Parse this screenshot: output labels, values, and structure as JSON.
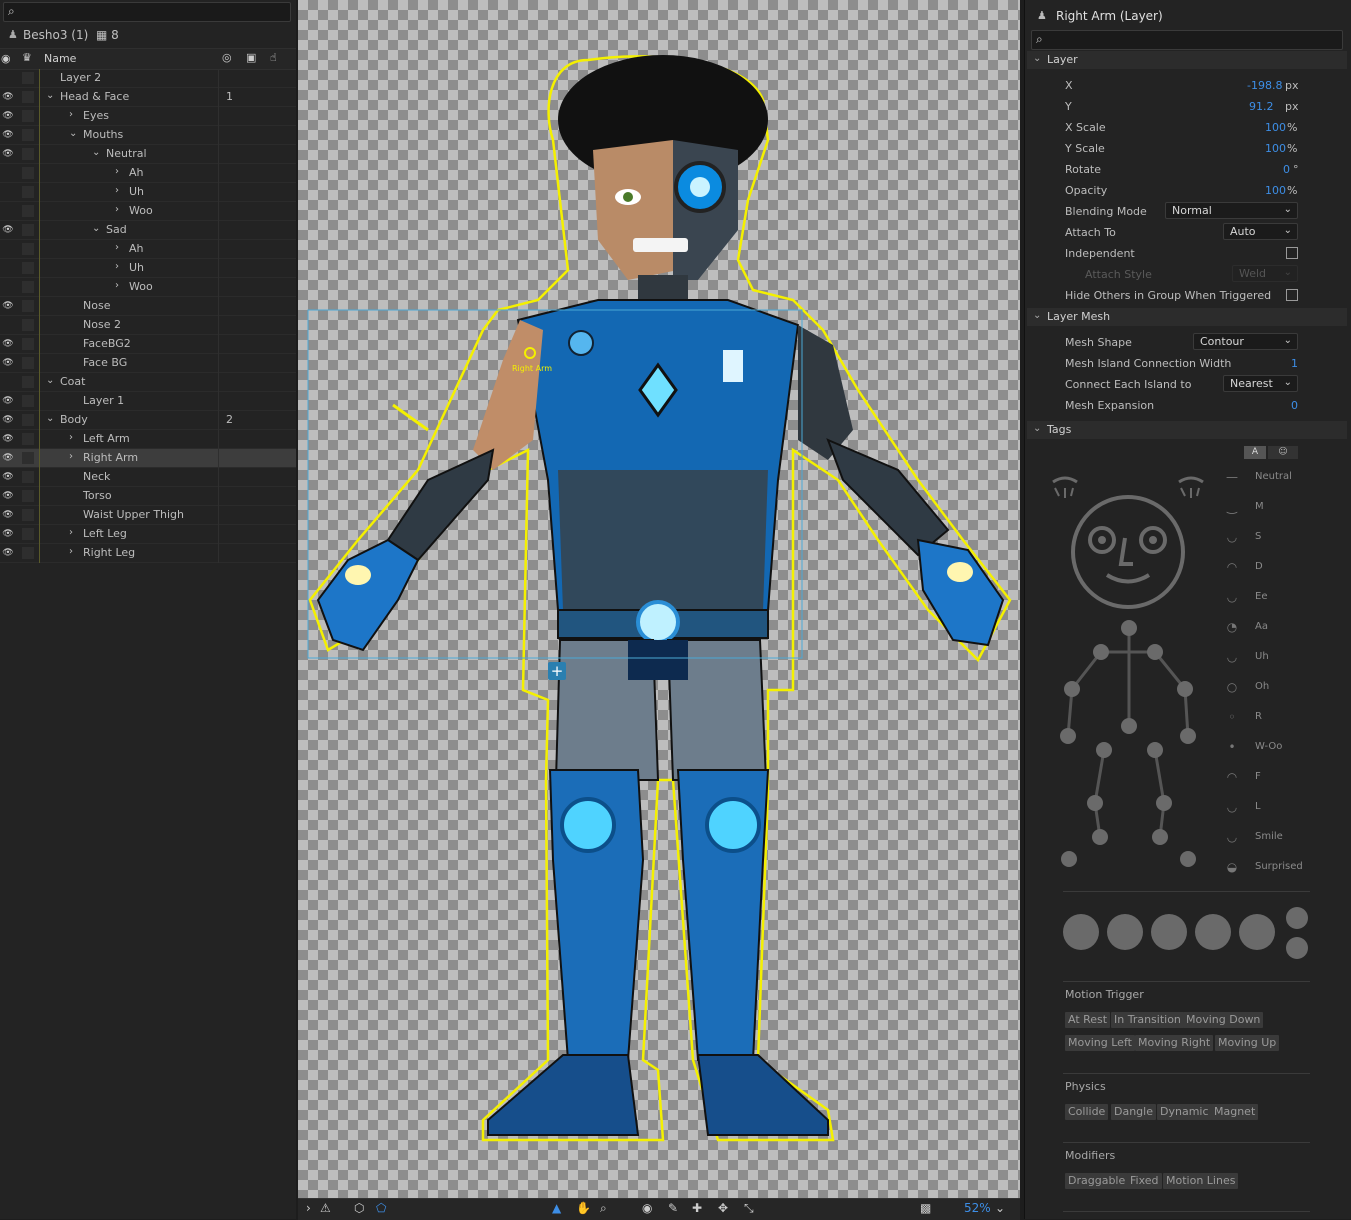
{
  "puppet": {
    "title": "Besho3 (1)",
    "count": "8"
  },
  "layers": {
    "header": {
      "name": "Name"
    },
    "rows": [
      {
        "label": "Layer 2",
        "depth": 1,
        "arrow": "",
        "eye": false,
        "num": ""
      },
      {
        "label": "Head & Face",
        "depth": 1,
        "arrow": "down",
        "eye": true,
        "num": "1"
      },
      {
        "label": "Eyes",
        "depth": 2,
        "arrow": "right",
        "eye": true,
        "num": ""
      },
      {
        "label": "Mouths",
        "depth": 2,
        "arrow": "down",
        "eye": true,
        "num": ""
      },
      {
        "label": "Neutral",
        "depth": 3,
        "arrow": "down",
        "eye": true,
        "num": ""
      },
      {
        "label": "Ah",
        "depth": 4,
        "arrow": "right",
        "eye": false,
        "num": ""
      },
      {
        "label": "Uh",
        "depth": 4,
        "arrow": "right",
        "eye": false,
        "num": ""
      },
      {
        "label": "Woo",
        "depth": 4,
        "arrow": "right",
        "eye": false,
        "num": ""
      },
      {
        "label": "Sad",
        "depth": 3,
        "arrow": "down",
        "eye": true,
        "num": ""
      },
      {
        "label": "Ah",
        "depth": 4,
        "arrow": "right",
        "eye": false,
        "num": ""
      },
      {
        "label": "Uh",
        "depth": 4,
        "arrow": "right",
        "eye": false,
        "num": ""
      },
      {
        "label": "Woo",
        "depth": 4,
        "arrow": "right",
        "eye": false,
        "num": ""
      },
      {
        "label": "Nose",
        "depth": 2,
        "arrow": "",
        "eye": true,
        "num": ""
      },
      {
        "label": "Nose 2",
        "depth": 2,
        "arrow": "",
        "eye": false,
        "num": ""
      },
      {
        "label": "FaceBG2",
        "depth": 2,
        "arrow": "",
        "eye": true,
        "num": ""
      },
      {
        "label": "Face BG",
        "depth": 2,
        "arrow": "",
        "eye": true,
        "num": ""
      },
      {
        "label": "Coat",
        "depth": 1,
        "arrow": "down",
        "eye": false,
        "num": ""
      },
      {
        "label": "Layer 1",
        "depth": 2,
        "arrow": "",
        "eye": true,
        "num": ""
      },
      {
        "label": "Body",
        "depth": 1,
        "arrow": "down",
        "eye": true,
        "num": "2"
      },
      {
        "label": "Left Arm",
        "depth": 2,
        "arrow": "right",
        "eye": true,
        "num": ""
      },
      {
        "label": "Right Arm",
        "depth": 2,
        "arrow": "right",
        "eye": true,
        "num": "",
        "selected": true
      },
      {
        "label": "Neck",
        "depth": 2,
        "arrow": "",
        "eye": true,
        "num": ""
      },
      {
        "label": "Torso",
        "depth": 2,
        "arrow": "",
        "eye": true,
        "num": ""
      },
      {
        "label": "Waist Upper Thigh",
        "depth": 2,
        "arrow": "",
        "eye": true,
        "num": ""
      },
      {
        "label": "Left Leg",
        "depth": 2,
        "arrow": "right",
        "eye": true,
        "num": ""
      },
      {
        "label": "Right Leg",
        "depth": 2,
        "arrow": "right",
        "eye": true,
        "num": ""
      }
    ]
  },
  "canvas": {
    "handle_label": "Right Arm",
    "zoom": "52%"
  },
  "props": {
    "title": "Right Arm (Layer)",
    "layer_section": "Layer",
    "x_label": "X",
    "x_val": "-198.8",
    "x_unit": "px",
    "y_label": "Y",
    "y_val": "91.2",
    "y_unit": "px",
    "xs_label": "X Scale",
    "xs_val": "100",
    "xs_unit": "%",
    "ys_label": "Y Scale",
    "ys_val": "100",
    "ys_unit": "%",
    "rot_label": "Rotate",
    "rot_val": "0",
    "rot_unit": "°",
    "op_label": "Opacity",
    "op_val": "100",
    "op_unit": "%",
    "blend_label": "Blending Mode",
    "blend_val": "Normal",
    "attach_label": "Attach To",
    "attach_val": "Auto",
    "indep_label": "Independent",
    "attach_style_label": "Attach Style",
    "attach_style_val": "Weld",
    "hide_label": "Hide Others in Group When Triggered",
    "mesh_section": "Layer Mesh",
    "mesh_shape_label": "Mesh Shape",
    "mesh_shape_val": "Contour",
    "island_label": "Mesh Island Connection Width",
    "island_val": "1",
    "connect_label": "Connect Each Island to",
    "connect_val": "Nearest",
    "expansion_label": "Mesh Expansion",
    "expansion_val": "0",
    "tags_section": "Tags",
    "tag_toggle_a": "A",
    "mouth_tags": [
      "Neutral",
      "M",
      "S",
      "D",
      "Ee",
      "Aa",
      "Uh",
      "Oh",
      "R",
      "W-Oo",
      "F",
      "L",
      "Smile",
      "Surprised"
    ],
    "motion_title": "Motion Trigger",
    "motion_chips": [
      "At Rest",
      "In Transition",
      "Moving Down",
      "Moving Left",
      "Moving Right",
      "Moving Up"
    ],
    "physics_title": "Physics",
    "physics_chips": [
      "Collide",
      "Dangle",
      "Dynamic",
      "Magnet"
    ],
    "modifiers_title": "Modifiers",
    "modifiers_chips": [
      "Draggable",
      "Fixed",
      "Motion Lines"
    ]
  }
}
